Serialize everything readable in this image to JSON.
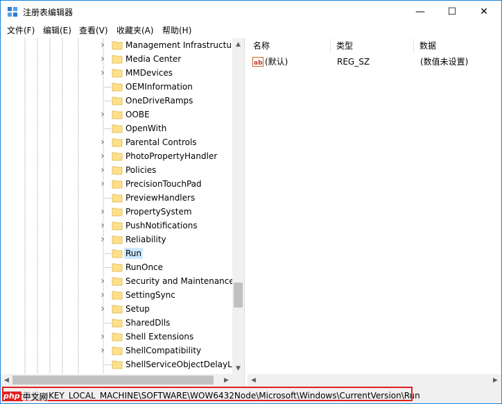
{
  "window": {
    "title": "注册表编辑器"
  },
  "title_buttons": {
    "minimize": "—",
    "maximize": "☐",
    "close": "✕"
  },
  "menu": [
    "文件(F)",
    "编辑(E)",
    "查看(V)",
    "收藏夹(A)",
    "帮助(H)"
  ],
  "tree": {
    "items": [
      {
        "label": "Management Infrastructure",
        "expandable": true
      },
      {
        "label": "Media Center",
        "expandable": true
      },
      {
        "label": "MMDevices",
        "expandable": true
      },
      {
        "label": "OEMInformation",
        "expandable": false
      },
      {
        "label": "OneDriveRamps",
        "expandable": false
      },
      {
        "label": "OOBE",
        "expandable": true
      },
      {
        "label": "OpenWith",
        "expandable": false
      },
      {
        "label": "Parental Controls",
        "expandable": true
      },
      {
        "label": "PhotoPropertyHandler",
        "expandable": true
      },
      {
        "label": "Policies",
        "expandable": true
      },
      {
        "label": "PrecisionTouchPad",
        "expandable": true
      },
      {
        "label": "PreviewHandlers",
        "expandable": false
      },
      {
        "label": "PropertySystem",
        "expandable": true
      },
      {
        "label": "PushNotifications",
        "expandable": true
      },
      {
        "label": "Reliability",
        "expandable": true
      },
      {
        "label": "Run",
        "expandable": false,
        "selected": true
      },
      {
        "label": "RunOnce",
        "expandable": false
      },
      {
        "label": "Security and Maintenance",
        "expandable": true
      },
      {
        "label": "SettingSync",
        "expandable": true
      },
      {
        "label": "Setup",
        "expandable": true
      },
      {
        "label": "SharedDlls",
        "expandable": false
      },
      {
        "label": "Shell Extensions",
        "expandable": true
      },
      {
        "label": "ShellCompatibility",
        "expandable": true
      },
      {
        "label": "ShellServiceObjectDelayLoad",
        "expandable": false
      }
    ]
  },
  "values": {
    "headers": {
      "name": "名称",
      "type": "类型",
      "data": "数据"
    },
    "rows": [
      {
        "name": "(默认)",
        "type": "REG_SZ",
        "data": "(数值未设置)"
      }
    ]
  },
  "status": {
    "path": "计算机\\HKEY_LOCAL_MACHINE\\SOFTWARE\\WOW6432Node\\Microsoft\\Windows\\CurrentVersion\\Run",
    "highlight_color": "#e02020"
  },
  "watermark": {
    "badge": "php",
    "text": "中文网"
  },
  "colors": {
    "selection": "#cce8ff",
    "folder": "#ffe08a",
    "window_border": "#1883d7"
  }
}
